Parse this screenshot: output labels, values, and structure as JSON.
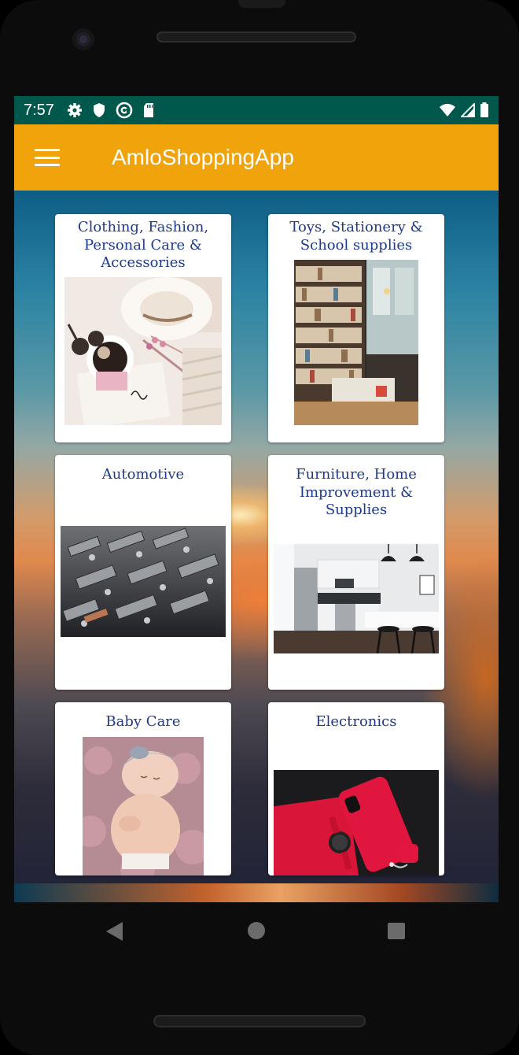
{
  "status_bar": {
    "time": "7:57",
    "icons": [
      "gear-icon",
      "shield-icon",
      "at-sign-icon",
      "sd-card-icon",
      "wifi-icon",
      "signal-icon",
      "battery-icon"
    ]
  },
  "app_bar": {
    "title": "AmloShoppingApp",
    "menu_icon": "hamburger-menu-icon"
  },
  "categories": [
    {
      "label": "Clothing, Fashion, Personal Care & Accessories",
      "image": "fashion-accessories-photo"
    },
    {
      "label": "Toys, Stationery & School supplies",
      "image": "stationery-shop-photo"
    },
    {
      "label": "Automotive",
      "image": "automotive-parts-photo"
    },
    {
      "label": "Furniture, Home Improvement & Supplies",
      "image": "kitchen-interior-photo"
    },
    {
      "label": "Baby Care",
      "image": "sleeping-baby-photo"
    },
    {
      "label": "Electronics",
      "image": "red-gadgets-photo"
    }
  ],
  "nav_bar": {
    "icons": [
      "back-triangle-icon",
      "home-circle-icon",
      "recents-square-icon"
    ]
  },
  "colors": {
    "status_bar": "#00574b",
    "app_bar": "#f0a30b",
    "card_label": "#1e3a8a"
  }
}
